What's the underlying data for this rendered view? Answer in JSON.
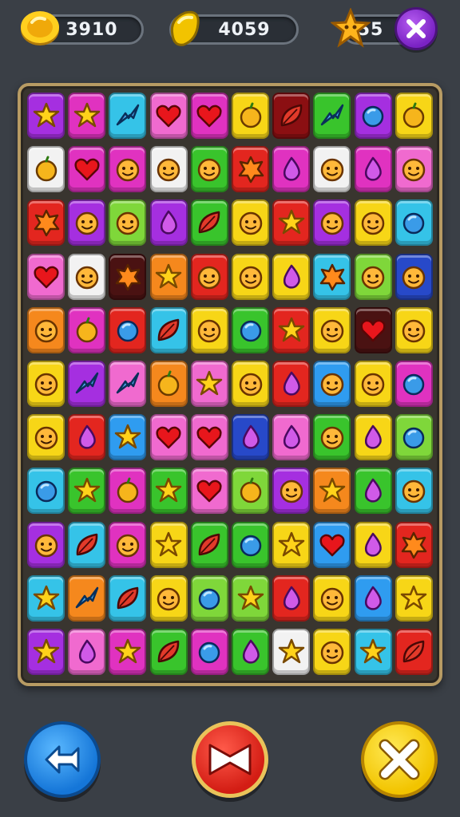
{
  "hud": {
    "coins": "3910",
    "gems": "4059",
    "stars": "55",
    "icons": {
      "coins": "gold-coin-icon",
      "gems": "yellow-gem-icon",
      "stars": "star-icon",
      "close": "close-icon"
    }
  },
  "board": {
    "rows": 11,
    "cols": 10,
    "colors": {
      "purple": "#a52fe0",
      "magenta": "#e032c0",
      "pink": "#f06acf",
      "red": "#e3261f",
      "darkred": "#8b0f12",
      "orange": "#f5881d",
      "yellow": "#f7d617",
      "green": "#39c42c",
      "lime": "#7fd73a",
      "blue": "#2f9cf0",
      "cyan": "#35c3e8",
      "navy": "#2749c9",
      "white": "#f2f2f2",
      "maroon": "#4a1212"
    },
    "tiles": [
      [
        [
          "purple",
          "star"
        ],
        [
          "magenta",
          "star"
        ],
        [
          "cyan",
          "zigzag"
        ],
        [
          "pink",
          "heart"
        ],
        [
          "magenta",
          "heart"
        ],
        [
          "yellow",
          "fruit"
        ],
        [
          "darkred",
          "leaf"
        ],
        [
          "green",
          "zigzag"
        ],
        [
          "purple",
          "ball"
        ],
        [
          "yellow",
          "fruit"
        ]
      ],
      [
        [
          "white",
          "fruit"
        ],
        [
          "magenta",
          "heart"
        ],
        [
          "magenta",
          "face"
        ],
        [
          "white",
          "face"
        ],
        [
          "green",
          "face"
        ],
        [
          "red",
          "burst"
        ],
        [
          "magenta",
          "drop"
        ],
        [
          "white",
          "face"
        ],
        [
          "magenta",
          "drop"
        ],
        [
          "pink",
          "face"
        ]
      ],
      [
        [
          "red",
          "burst"
        ],
        [
          "purple",
          "face"
        ],
        [
          "lime",
          "face"
        ],
        [
          "purple",
          "drop"
        ],
        [
          "green",
          "leaf"
        ],
        [
          "yellow",
          "face"
        ],
        [
          "red",
          "star"
        ],
        [
          "purple",
          "face"
        ],
        [
          "yellow",
          "face"
        ],
        [
          "cyan",
          "ball"
        ]
      ],
      [
        [
          "pink",
          "heart"
        ],
        [
          "white",
          "face"
        ],
        [
          "maroon",
          "burst"
        ],
        [
          "orange",
          "star"
        ],
        [
          "red",
          "face"
        ],
        [
          "yellow",
          "face"
        ],
        [
          "yellow",
          "drop"
        ],
        [
          "cyan",
          "burst"
        ],
        [
          "lime",
          "face"
        ],
        [
          "navy",
          "face"
        ]
      ],
      [
        [
          "orange",
          "face"
        ],
        [
          "magenta",
          "fruit"
        ],
        [
          "red",
          "ball"
        ],
        [
          "cyan",
          "leaf"
        ],
        [
          "yellow",
          "face"
        ],
        [
          "green",
          "ball"
        ],
        [
          "red",
          "star"
        ],
        [
          "yellow",
          "face"
        ],
        [
          "maroon",
          "heart"
        ],
        [
          "yellow",
          "face"
        ]
      ],
      [
        [
          "yellow",
          "face"
        ],
        [
          "purple",
          "zigzag"
        ],
        [
          "pink",
          "zigzag"
        ],
        [
          "orange",
          "fruit"
        ],
        [
          "pink",
          "star"
        ],
        [
          "yellow",
          "face"
        ],
        [
          "red",
          "drop"
        ],
        [
          "blue",
          "face"
        ],
        [
          "yellow",
          "face"
        ],
        [
          "magenta",
          "ball"
        ]
      ],
      [
        [
          "yellow",
          "face"
        ],
        [
          "red",
          "drop"
        ],
        [
          "blue",
          "star"
        ],
        [
          "pink",
          "heart"
        ],
        [
          "pink",
          "heart"
        ],
        [
          "navy",
          "drop"
        ],
        [
          "pink",
          "drop"
        ],
        [
          "green",
          "face"
        ],
        [
          "yellow",
          "drop"
        ],
        [
          "lime",
          "ball"
        ]
      ],
      [
        [
          "cyan",
          "ball"
        ],
        [
          "green",
          "star"
        ],
        [
          "magenta",
          "fruit"
        ],
        [
          "green",
          "star"
        ],
        [
          "pink",
          "heart"
        ],
        [
          "lime",
          "fruit"
        ],
        [
          "purple",
          "face"
        ],
        [
          "orange",
          "star"
        ],
        [
          "green",
          "drop"
        ],
        [
          "cyan",
          "face"
        ]
      ],
      [
        [
          "purple",
          "face"
        ],
        [
          "cyan",
          "leaf"
        ],
        [
          "magenta",
          "face"
        ],
        [
          "yellow",
          "star"
        ],
        [
          "green",
          "leaf"
        ],
        [
          "green",
          "ball"
        ],
        [
          "yellow",
          "star"
        ],
        [
          "blue",
          "heart"
        ],
        [
          "yellow",
          "drop"
        ],
        [
          "red",
          "burst"
        ]
      ],
      [
        [
          "cyan",
          "star"
        ],
        [
          "orange",
          "zigzag"
        ],
        [
          "cyan",
          "leaf"
        ],
        [
          "yellow",
          "face"
        ],
        [
          "lime",
          "ball"
        ],
        [
          "lime",
          "star"
        ],
        [
          "red",
          "drop"
        ],
        [
          "yellow",
          "face"
        ],
        [
          "blue",
          "drop"
        ],
        [
          "yellow",
          "star"
        ]
      ],
      [
        [
          "purple",
          "star"
        ],
        [
          "pink",
          "drop"
        ],
        [
          "magenta",
          "star"
        ],
        [
          "green",
          "leaf"
        ],
        [
          "magenta",
          "ball"
        ],
        [
          "green",
          "drop"
        ],
        [
          "white",
          "star"
        ],
        [
          "yellow",
          "face"
        ],
        [
          "cyan",
          "star"
        ],
        [
          "red",
          "leaf"
        ]
      ]
    ]
  },
  "controls": {
    "left": "shuffle-icon",
    "middle": "bowtie-icon",
    "right": "cross-icon"
  }
}
